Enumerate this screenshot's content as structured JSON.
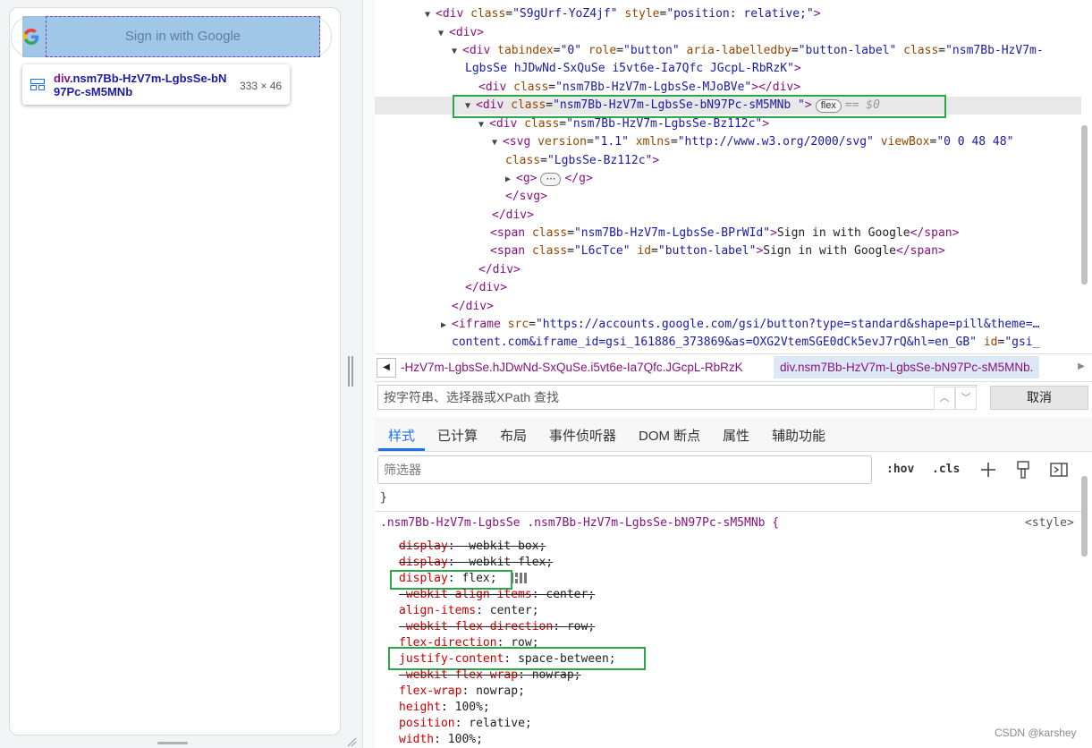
{
  "preview": {
    "button_text": "Sign in with Google",
    "tooltip": {
      "selector_tag": "div",
      "selector_class_line1": ".nsm7Bb-HzV7m-LgbsSe-bN",
      "selector_class_line2": "97Pc-sM5MNb",
      "size": "333 × 46"
    }
  },
  "dom_tree": {
    "lines": [
      {
        "t1": "<div ",
        "a1": "class",
        "v1": "\"S9gUrf-YoZ4jf\"",
        "a2": "style",
        "v2": "\"position: relative;\"",
        "t2": ">"
      },
      {
        "t1": "<div>"
      },
      {
        "t1": "<div ",
        "a1": "tabindex",
        "v1": "\"0\"",
        "a2": "role",
        "v2": "\"button\"",
        "a3": "aria-labelledby",
        "v3": "\"button-label\"",
        "a4": "class",
        "v4": "\"nsm7Bb-HzV7m-"
      },
      {
        "v1": "LgbsSe  hJDwNd-SxQuSe i5vt6e-Ia7Qfc JGcpL-RbRzK\"",
        "t2": ">"
      },
      {
        "t1": "<div ",
        "a1": "class",
        "v1": "\"nsm7Bb-HzV7m-LgbsSe-MJoBVe\"",
        "t2": "></div>"
      },
      {
        "t1": "<div ",
        "a1": "class",
        "v1": "\"nsm7Bb-HzV7m-LgbsSe-bN97Pc-sM5MNb \"",
        "t2": ">",
        "badge": "flex",
        "eq": "== $0"
      },
      {
        "t1": "<div ",
        "a1": "class",
        "v1": "\"nsm7Bb-HzV7m-LgbsSe-Bz112c\"",
        "t2": ">"
      },
      {
        "t1": "<svg ",
        "a1": "version",
        "v1": "\"1.1\"",
        "a2": "xmlns",
        "v2": "\"http://www.w3.org/2000/svg\"",
        "a3": "viewBox",
        "v3": "\"0 0 48 48\""
      },
      {
        "a1": "class",
        "v1": "\"LgbsSe-Bz112c\"",
        "t2": ">"
      },
      {
        "t1": "<g>",
        "dots": "⋯",
        "t2": "</g>"
      },
      {
        "t1": "</svg>"
      },
      {
        "t1": "</div>"
      },
      {
        "t1": "<span ",
        "a1": "class",
        "v1": "\"nsm7Bb-HzV7m-LgbsSe-BPrWId\"",
        "t2": ">",
        "text": "Sign in with Google",
        "t3": "</span>"
      },
      {
        "t1": "<span ",
        "a1": "class",
        "v1": "\"L6cTce\"",
        "a2": "id",
        "v2": "\"button-label\"",
        "t2": ">",
        "text": "Sign in with Google",
        "t3": "</span>"
      },
      {
        "t1": "</div>"
      },
      {
        "t1": "</div>"
      },
      {
        "t1": "</div>"
      },
      {
        "t1": "<iframe ",
        "a1": "src",
        "v1": "\"https://accounts.google.com/gsi/button?type=standard&shape=pill&theme=…"
      },
      {
        "v1": "content.com&iframe_id=gsi_161886_373869&as=OXG2VtemSGE0dCk5evJ7rQ&hl=en_GB\"",
        "a2": "id",
        "v2": "\"gsi_"
      }
    ]
  },
  "breadcrumbs": {
    "item1": "-HzV7m-LgbsSe.hJDwNd-SxQuSe.i5vt6e-Ia7Qfc.JGcpL-RbRzK",
    "item2": "div.nsm7Bb-HzV7m-LgbsSe-bN97Pc-sM5MNb."
  },
  "search": {
    "placeholder": "按字符串、选择器或XPath 查找",
    "cancel_label": "取消"
  },
  "tabs": [
    "样式",
    "已计算",
    "布局",
    "事件侦听器",
    "DOM 断点",
    "属性",
    "辅助功能"
  ],
  "styles": {
    "filter_placeholder": "筛选器",
    "hov_label": ":hov",
    "cls_label": ".cls",
    "close_brace": "}",
    "rule_selector": ".nsm7Bb-HzV7m-LgbsSe .nsm7Bb-HzV7m-LgbsSe-bN97Pc-sM5MNb {",
    "rule_origin": "<style>",
    "declarations": [
      {
        "prop": "display",
        "val": "-webkit-box;",
        "struck": true
      },
      {
        "prop": "display",
        "val": "-webkit-flex;",
        "struck": true
      },
      {
        "prop": "display",
        "val": "flex;",
        "struck": false
      },
      {
        "prop": "-webkit-align-items",
        "val": "center;",
        "struck": true
      },
      {
        "prop": "align-items",
        "val": "center;",
        "struck": false
      },
      {
        "prop": "-webkit-flex-direction",
        "val": "row;",
        "struck": true
      },
      {
        "prop": "flex-direction",
        "val": "row;",
        "struck": false
      },
      {
        "prop": "justify-content",
        "val": "space-between;",
        "struck": false
      },
      {
        "prop": "-webkit-flex-wrap",
        "val": "nowrap;",
        "struck": true
      },
      {
        "prop": "flex-wrap",
        "val": "nowrap;",
        "struck": false
      },
      {
        "prop": "height",
        "val": "100%;",
        "struck": false
      },
      {
        "prop": "position",
        "val": "relative;",
        "struck": false
      },
      {
        "prop": "width",
        "val": "100%;",
        "struck": false
      }
    ]
  },
  "watermark": "CSDN @karshey",
  "colors": {
    "highlight": "#6fa8dc",
    "green_box": "#2aa84a",
    "tag": "#881280",
    "attr_name": "#994500",
    "attr_value": "#1a1aa6",
    "css_prop": "#c80000"
  }
}
